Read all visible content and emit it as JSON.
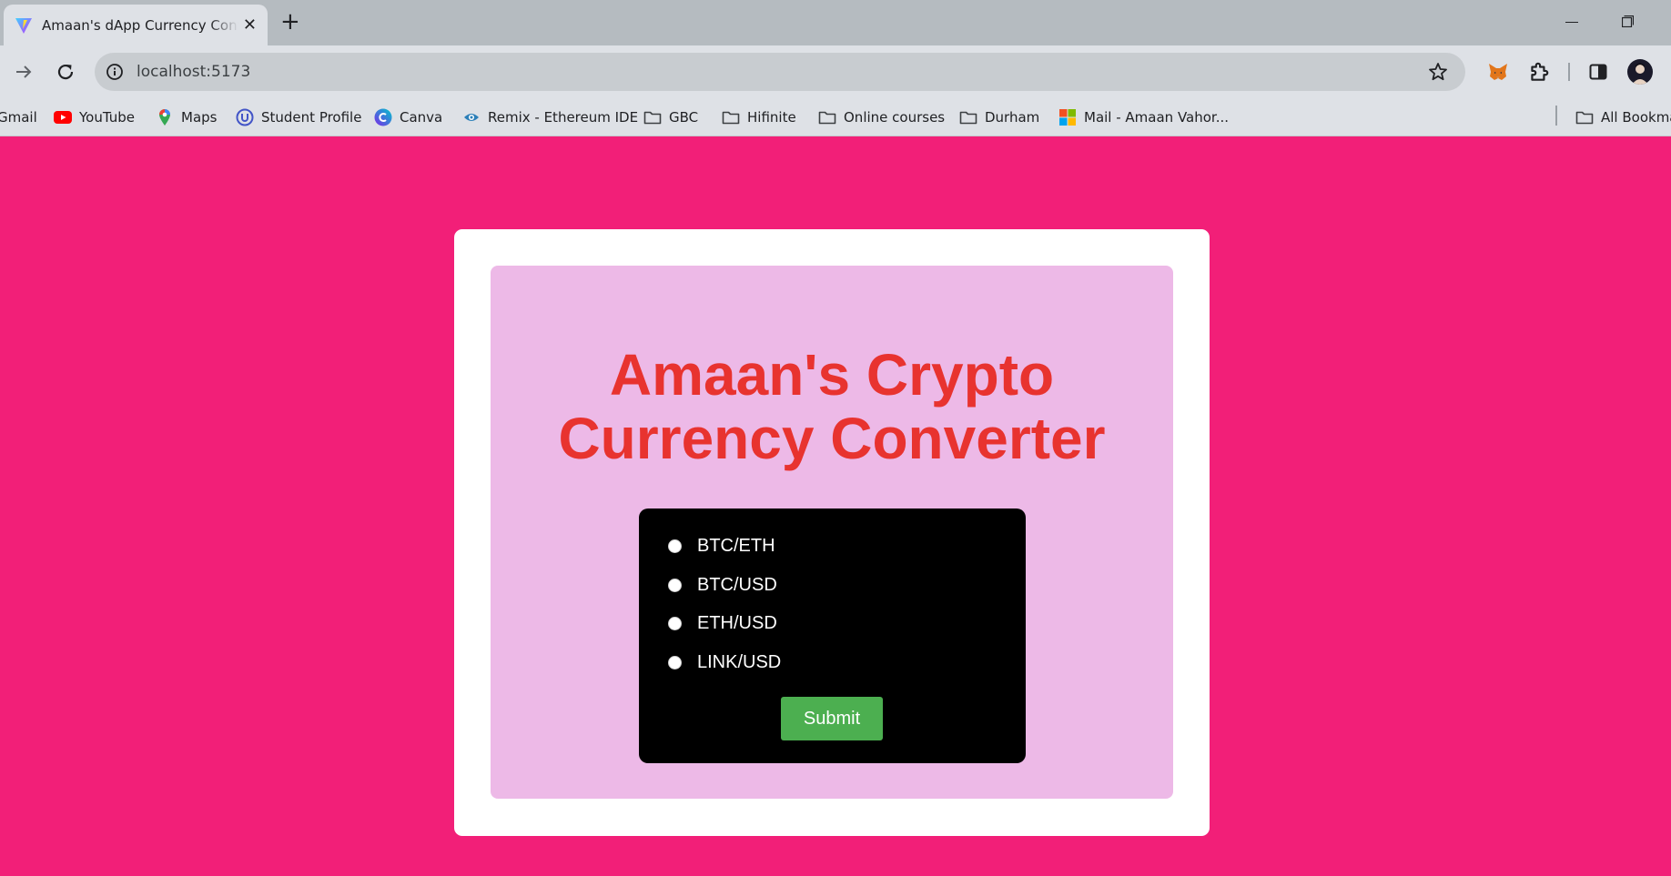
{
  "browser": {
    "tab_title": "Amaan's dApp Currency Converter",
    "tab_close": "✕",
    "new_tab": "+",
    "url": "localhost:5173",
    "bookmarks": [
      {
        "label": "Gmail",
        "icon": "gmail-icon"
      },
      {
        "label": "YouTube",
        "icon": "youtube-icon"
      },
      {
        "label": "Maps",
        "icon": "maps-icon"
      },
      {
        "label": "Student Profile",
        "icon": "student-profile-icon"
      },
      {
        "label": "Canva",
        "icon": "canva-icon"
      },
      {
        "label": "Remix - Ethereum IDE",
        "icon": "remix-icon"
      },
      {
        "label": "GBC",
        "icon": "folder-icon"
      },
      {
        "label": "Hifinite",
        "icon": "folder-icon"
      },
      {
        "label": "Online courses",
        "icon": "folder-icon"
      },
      {
        "label": "Durham",
        "icon": "folder-icon"
      },
      {
        "label": "Mail - Amaan Vahor...",
        "icon": "microsoft-icon"
      }
    ],
    "all_bookmarks": "All Bookmarks"
  },
  "app": {
    "title": "Amaan's Crypto Currency Converter",
    "options": [
      {
        "label": "BTC/ETH",
        "selected": false
      },
      {
        "label": "BTC/USD",
        "selected": false
      },
      {
        "label": "ETH/USD",
        "selected": false
      },
      {
        "label": "LINK/USD",
        "selected": false
      }
    ],
    "submit_label": "Submit"
  },
  "colors": {
    "page_background": "#f21f78",
    "card_background": "#ffffff",
    "inner_background": "#edb9e7",
    "title_color": "#e8332f",
    "form_background": "#000000",
    "submit_background": "#4caf50"
  }
}
